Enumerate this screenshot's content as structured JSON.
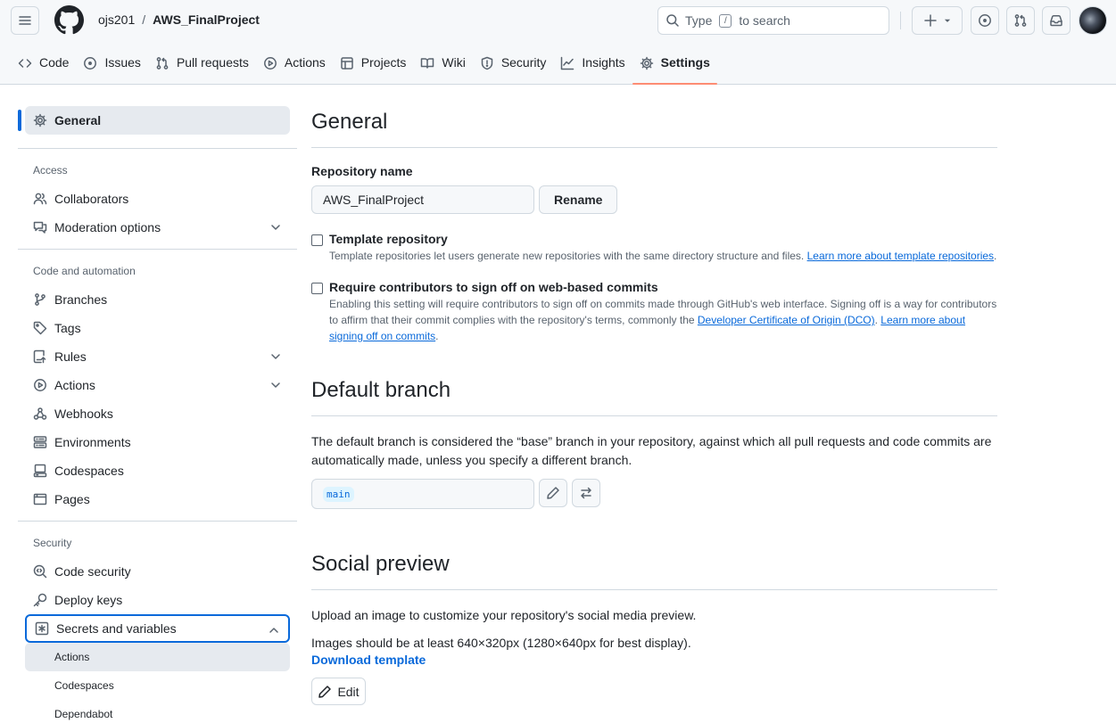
{
  "header": {
    "owner": "ojs201",
    "separator": "/",
    "repo": "AWS_FinalProject",
    "search": {
      "prefix": "Type",
      "key": "/",
      "suffix": "to search"
    }
  },
  "nav": {
    "tabs": [
      {
        "label": "Code",
        "icon": "code-icon"
      },
      {
        "label": "Issues",
        "icon": "issue-opened-icon"
      },
      {
        "label": "Pull requests",
        "icon": "git-pull-request-icon"
      },
      {
        "label": "Actions",
        "icon": "play-icon"
      },
      {
        "label": "Projects",
        "icon": "table-icon"
      },
      {
        "label": "Wiki",
        "icon": "book-icon"
      },
      {
        "label": "Security",
        "icon": "shield-icon"
      },
      {
        "label": "Insights",
        "icon": "graph-icon"
      },
      {
        "label": "Settings",
        "icon": "gear-icon",
        "selected": true
      }
    ]
  },
  "sidebar": {
    "general": "General",
    "access_heading": "Access",
    "collaborators": "Collaborators",
    "moderation": "Moderation options",
    "code_heading": "Code and automation",
    "branches": "Branches",
    "tags": "Tags",
    "rules": "Rules",
    "actions": "Actions",
    "webhooks": "Webhooks",
    "environments": "Environments",
    "codespaces": "Codespaces",
    "pages": "Pages",
    "security_heading": "Security",
    "code_security": "Code security",
    "deploy_keys": "Deploy keys",
    "secrets": "Secrets and variables",
    "sub_actions": "Actions",
    "sub_codespaces": "Codespaces",
    "sub_dependabot": "Dependabot"
  },
  "main": {
    "general_title": "General",
    "repo_name_label": "Repository name",
    "repo_name_value": "AWS_FinalProject",
    "rename_button": "Rename",
    "template_title": "Template repository",
    "template_desc": "Template repositories let users generate new repositories with the same directory structure and files.",
    "template_link": "Learn more about template repositories",
    "signoff_title": "Require contributors to sign off on web-based commits",
    "signoff_desc_1": "Enabling this setting will require contributors to sign off on commits made through GitHub's web interface. Signing off is a way for contributors to affirm that their commit complies with the repository's terms, commonly the",
    "signoff_link_dco": "Developer Certificate of Origin (DCO)",
    "signoff_link_more": "Learn more about signing off on commits",
    "default_branch_title": "Default branch",
    "default_branch_desc": "The default branch is considered the “base” branch in your repository, against which all pull requests and code commits are automatically made, unless you specify a different branch.",
    "branch_name": "main",
    "social_title": "Social preview",
    "social_desc": "Upload an image to customize your repository's social media preview.",
    "social_size": "Images should be at least 640×320px (1280×640px for best display).",
    "download_template": "Download template",
    "edit_button": "Edit"
  },
  "colors": {
    "accent": "#0969da",
    "tab_underline": "#fd8c73",
    "border": "#d1d9e0"
  }
}
